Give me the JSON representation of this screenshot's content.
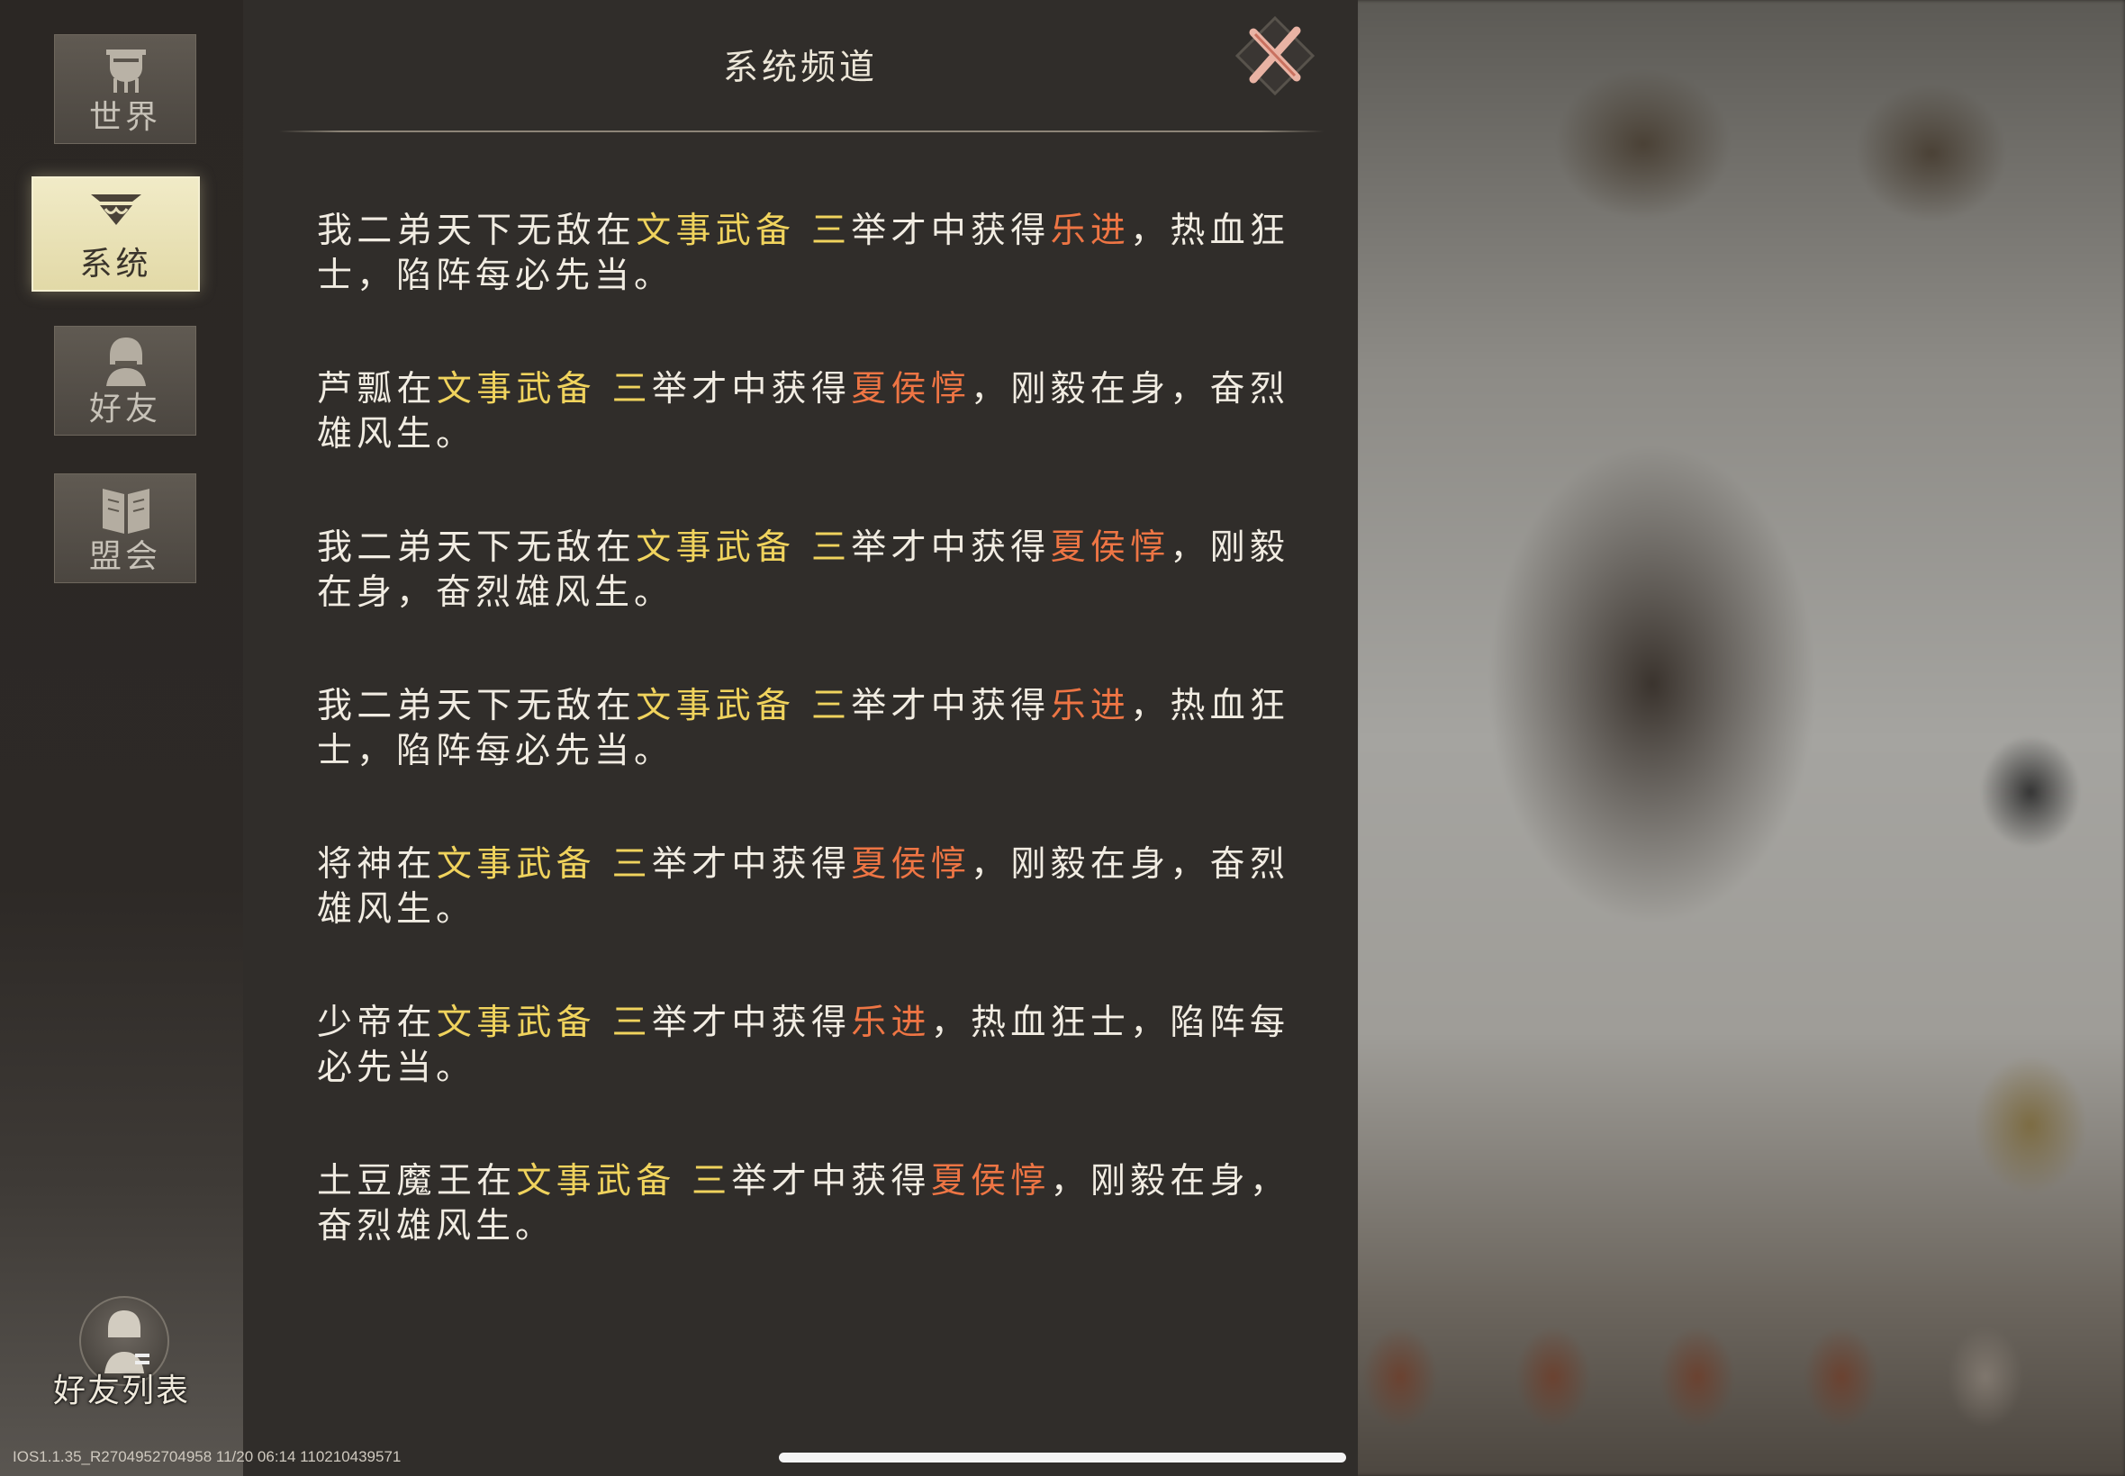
{
  "panel": {
    "title": "系统频道"
  },
  "sidebar": {
    "tabs": [
      {
        "label": "世界",
        "icon": "bronze-vessel-icon"
      },
      {
        "label": "系统",
        "icon": "system-emblem-icon",
        "active": true
      },
      {
        "label": "好友",
        "icon": "helmet-warrior-icon"
      },
      {
        "label": "盟会",
        "icon": "book-banner-icon"
      }
    ],
    "friend_list_label": "好友列表"
  },
  "messages": [
    {
      "player": "我二弟天下无敌",
      "pre": "在",
      "event": "文事武备 三",
      "mid": "举才中获得",
      "hero": "乐进",
      "post": "，热血狂士，陷阵每必先当。"
    },
    {
      "player": "芦瓢",
      "pre": "在",
      "event": "文事武备 三",
      "mid": "举才中获得",
      "hero": "夏侯惇",
      "post": "，刚毅在身，奋烈雄风生。"
    },
    {
      "player": "我二弟天下无敌",
      "pre": "在",
      "event": "文事武备 三",
      "mid": "举才中获得",
      "hero": "夏侯惇",
      "post": "，刚毅在身，奋烈雄风生。"
    },
    {
      "player": "我二弟天下无敌",
      "pre": "在",
      "event": "文事武备 三",
      "mid": "举才中获得",
      "hero": "乐进",
      "post": "，热血狂士，陷阵每必先当。"
    },
    {
      "player": "将神",
      "pre": "在",
      "event": "文事武备 三",
      "mid": "举才中获得",
      "hero": "夏侯惇",
      "post": "，刚毅在身，奋烈雄风生。"
    },
    {
      "player": "少帝",
      "pre": "在",
      "event": "文事武备 三",
      "mid": "举才中获得",
      "hero": "乐进",
      "post": "，热血狂士，陷阵每必先当。"
    },
    {
      "player": "土豆魔王",
      "pre": "在",
      "event": "文事武备 三",
      "mid": "举才中获得",
      "hero": "夏侯惇",
      "post": "，刚毅在身，奋烈雄风生。"
    }
  ],
  "footer": {
    "version": "IOS1.1.35_R2704952704958 11/20 06:14 110210439571"
  },
  "colors": {
    "event_highlight": "#f0d35d",
    "hero_highlight": "#ee7544",
    "text": "#f1ece2"
  }
}
